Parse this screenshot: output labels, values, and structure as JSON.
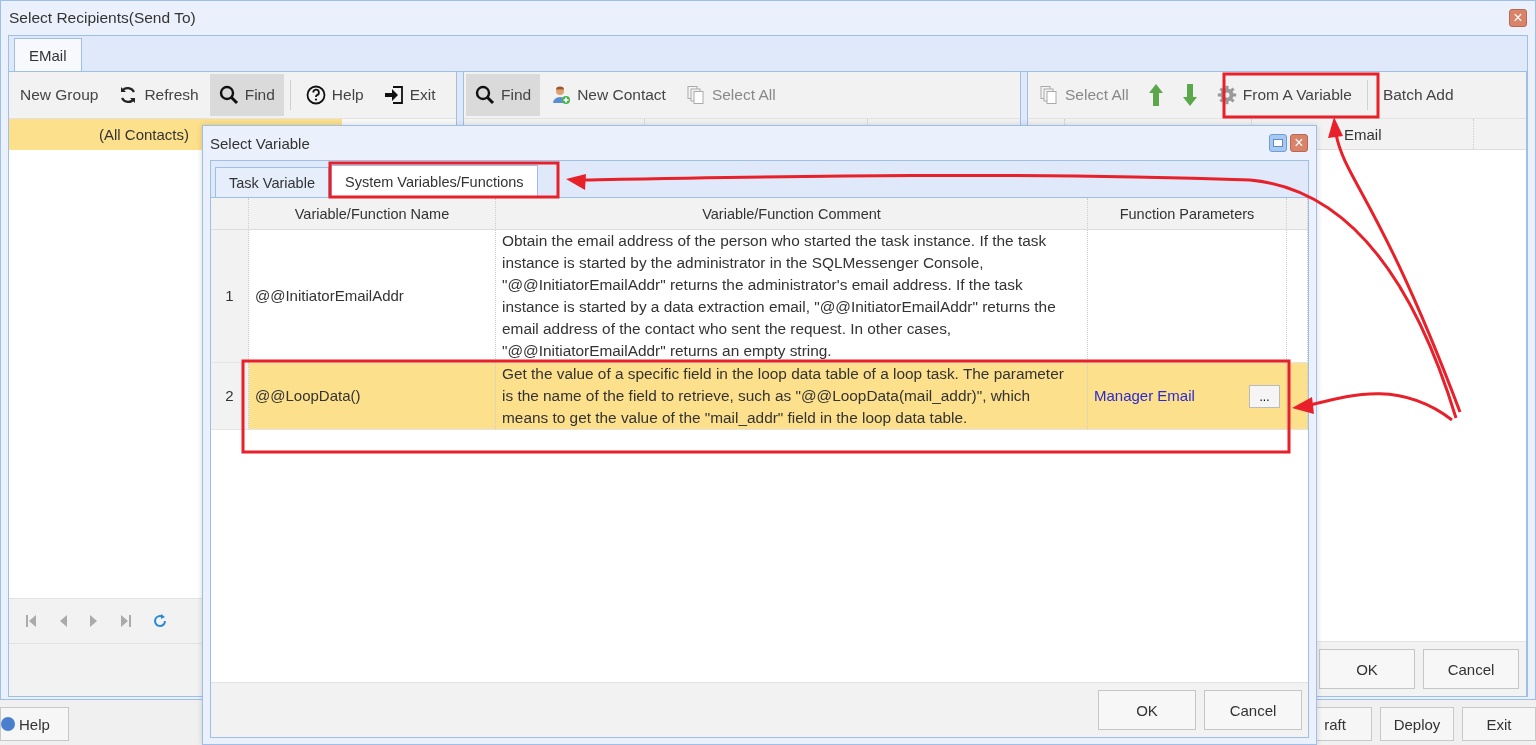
{
  "background_window": {
    "help_button": "Help",
    "buttons": [
      "raft",
      "Deploy",
      "Exit"
    ]
  },
  "window": {
    "title": "Select Recipients(Send To)",
    "close": "×"
  },
  "tabs": [
    {
      "label": "EMail",
      "selected": true
    }
  ],
  "groups_panel": {
    "toolbar_groups": [
      [
        {
          "label": "New Group",
          "pressed": false
        },
        {
          "label": "Refresh",
          "pressed": false
        },
        {
          "label": "Find",
          "pressed": true
        }
      ],
      [
        {
          "label": "Help",
          "pressed": false
        },
        {
          "label": "Exit",
          "pressed": false
        }
      ]
    ],
    "items": [
      {
        "label": "(All Contacts)",
        "selected": true
      }
    ]
  },
  "contacts_panel": {
    "toolbar": [
      {
        "label": "Find",
        "pressed": true,
        "disabled": false
      },
      {
        "label": "New Contact",
        "pressed": false,
        "disabled": false
      },
      {
        "label": "Select All",
        "pressed": false,
        "disabled": true
      }
    ]
  },
  "recipients_panel": {
    "toolbar": [
      {
        "label": "Select All",
        "disabled": true
      },
      {
        "label": "From A Variable",
        "disabled": false
      },
      {
        "label": "Batch Add",
        "disabled": false
      }
    ],
    "columns": [
      "Email"
    ],
    "buttons": [
      "OK",
      "Cancel"
    ]
  },
  "dialog": {
    "title": "Select Variable",
    "tabs": [
      {
        "label": "Task Variable",
        "selected": false
      },
      {
        "label": "System Variables/Functions",
        "selected": true
      }
    ],
    "columns": [
      "Variable/Function Name",
      "Variable/Function Comment",
      "Function Parameters"
    ],
    "rows": [
      {
        "number": "1",
        "name": "@@InitiatorEmailAddr",
        "comment": "Obtain the email address of the person who started the task instance. If the task instance is started by the administrator in the SQLMessenger Console, \"@@InitiatorEmailAddr\" returns the administrator's email address. If the task instance is started by a data extraction email, \"@@InitiatorEmailAddr\" returns the email address of the contact who sent the request. In other cases, \"@@InitiatorEmailAddr\" returns an empty string.",
        "selected": false
      },
      {
        "number": "2",
        "name": "@@LoopData()",
        "comment": "Get the value of a specific field in the loop data table of a loop task. The parameter is the name of the field to retrieve, such as \"@@LoopData(mail_addr)\", which means to get the value of the \"mail_addr\" field in the loop data table.",
        "parameters": "Manager Email",
        "button": "...",
        "selected": true
      }
    ],
    "buttons": [
      "OK",
      "Cancel"
    ]
  }
}
